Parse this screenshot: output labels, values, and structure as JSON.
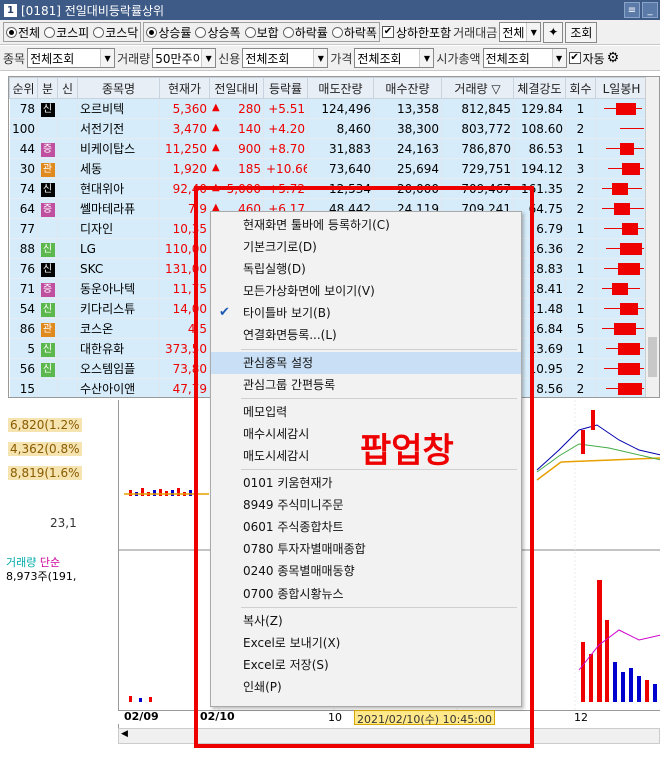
{
  "window": {
    "number": "1",
    "title": "[0181] 전일대비등락률상위"
  },
  "filters": {
    "market_radios": [
      {
        "label": "전체",
        "on": true
      },
      {
        "label": "코스피",
        "on": false
      },
      {
        "label": "코스닥",
        "on": false
      }
    ],
    "sort_radios": [
      {
        "label": "상승률",
        "on": true
      },
      {
        "label": "상승폭",
        "on": false
      },
      {
        "label": "보합",
        "on": false
      },
      {
        "label": "하락률",
        "on": false
      },
      {
        "label": "하락폭",
        "on": false
      }
    ],
    "limit_check": {
      "label": "상하한포함",
      "checked": true
    },
    "trade_amount_label": "거래대금",
    "trade_amount_value": "전체",
    "lookup_button": "조회",
    "item_label": "종목",
    "item_value": "전체조회",
    "volume_label": "거래량",
    "volume_value": "50만주이상",
    "credit_label": "신용",
    "credit_value": "전체조회",
    "price_label": "가격",
    "price_value": "전체조회",
    "mcap_label": "시가총액",
    "mcap_value": "전체조회",
    "auto_check": {
      "label": "자동",
      "checked": true
    }
  },
  "table": {
    "headers": [
      "순위",
      "분",
      "신",
      "종목명",
      "현재가",
      "전일대비",
      "등락률",
      "매도잔량",
      "매수잔량",
      "거래량 ▽",
      "체결강도",
      "회수",
      "L일봉H"
    ],
    "rows": [
      {
        "rank": "78",
        "tag": "신",
        "tag_type": "sin",
        "name": "오르비텍",
        "price": "5,360",
        "chg": "280",
        "rate": "+5.51",
        "ask": "124,496",
        "bid": "13,358",
        "vol": "812,845",
        "str": "129.84",
        "cnt": "1"
      },
      {
        "rank": "100",
        "tag": "",
        "tag_type": "",
        "name": "서전기전",
        "price": "3,470",
        "chg": "140",
        "rate": "+4.20",
        "ask": "8,460",
        "bid": "38,300",
        "vol": "803,772",
        "str": "108.60",
        "cnt": "2"
      },
      {
        "rank": "44",
        "tag": "증",
        "tag_type": "jung",
        "name": "비케이탑스",
        "price": "11,250",
        "chg": "900",
        "rate": "+8.70",
        "ask": "31,883",
        "bid": "24,163",
        "vol": "786,870",
        "str": "86.53",
        "cnt": "1"
      },
      {
        "rank": "30",
        "tag": "관",
        "tag_type": "pan",
        "name": "세동",
        "price": "1,920",
        "chg": "185",
        "rate": "+10.66",
        "ask": "73,640",
        "bid": "25,694",
        "vol": "729,751",
        "str": "194.12",
        "cnt": "3"
      },
      {
        "rank": "74",
        "tag": "신",
        "tag_type": "sin",
        "name": "현대위아",
        "price": "92,40",
        "chg": "5,000",
        "rate": "+5.72",
        "ask": "12,534",
        "bid": "20,000",
        "vol": "709,467",
        "str": "161.35",
        "cnt": "2"
      },
      {
        "rank": "64",
        "tag": "증",
        "tag_type": "jung",
        "name": "쎌마테라퓨",
        "price": "7,9",
        "chg": "460",
        "rate": "+6.17",
        "ask": "48,442",
        "bid": "24,119",
        "vol": "709,241",
        "str": "64.75",
        "cnt": "2"
      },
      {
        "rank": "77",
        "tag": "",
        "tag_type": "",
        "name": "디자인",
        "price": "10,35",
        "chg": "",
        "rate": "",
        "ask": "",
        "bid": "",
        "vol": "",
        "str": "6.79",
        "cnt": "1"
      },
      {
        "rank": "88",
        "tag": "신",
        "tag_type": "sin2",
        "name": "LG",
        "price": "110,00",
        "chg": "",
        "rate": "",
        "ask": "",
        "bid": "",
        "vol": "",
        "str": "16.36",
        "cnt": "2"
      },
      {
        "rank": "76",
        "tag": "신",
        "tag_type": "sin",
        "name": "SKC",
        "price": "131,00",
        "chg": "",
        "rate": "",
        "ask": "",
        "bid": "",
        "vol": "",
        "str": "18.83",
        "cnt": "1"
      },
      {
        "rank": "71",
        "tag": "증",
        "tag_type": "jung",
        "name": "동운아나텍",
        "price": "11,75",
        "chg": "",
        "rate": "",
        "ask": "",
        "bid": "",
        "vol": "",
        "str": "18.41",
        "cnt": "2"
      },
      {
        "rank": "54",
        "tag": "신",
        "tag_type": "sin2",
        "name": "키다리스튜",
        "price": "14,00",
        "chg": "",
        "rate": "",
        "ask": "",
        "bid": "",
        "vol": "",
        "str": "11.48",
        "cnt": "1"
      },
      {
        "rank": "86",
        "tag": "관",
        "tag_type": "pan",
        "name": "코스온",
        "price": "4,5",
        "chg": "",
        "rate": "",
        "ask": "",
        "bid": "",
        "vol": "",
        "str": "16.84",
        "cnt": "5"
      },
      {
        "rank": "5",
        "tag": "신",
        "tag_type": "sin2",
        "name": "대한유화",
        "price": "373,50",
        "chg": "",
        "rate": "",
        "ask": "",
        "bid": "",
        "vol": "",
        "str": "13.69",
        "cnt": "1"
      },
      {
        "rank": "56",
        "tag": "신",
        "tag_type": "sin2",
        "name": "오스템임플",
        "price": "73,80",
        "chg": "",
        "rate": "",
        "ask": "",
        "bid": "",
        "vol": "",
        "str": "10.95",
        "cnt": "2"
      },
      {
        "rank": "15",
        "tag": "",
        "tag_type": "",
        "name": "수산아이앤",
        "price": "47,79",
        "chg": "",
        "rate": "",
        "ask": "",
        "bid": "",
        "vol": "",
        "str": "8.56",
        "cnt": "2"
      }
    ]
  },
  "chart": {
    "info1": "6,820(1.2%",
    "info2": "4,362(0.8%",
    "info3": "8,819(1.6%",
    "info4": "23,1",
    "vol_title": "거래량",
    "vol_unit": "단순",
    "vol_value": "8,973주(191,",
    "date_left": "02/09",
    "date_mid": "02/10",
    "date_10": "10",
    "date_11": "11",
    "date_12": "12",
    "tooltip": "2021/02/10(수) 10:45:00"
  },
  "menu": {
    "items": [
      {
        "label": "현재화면 툴바에 등록하기(C)",
        "check": false,
        "hl": false
      },
      {
        "label": "기본크기로(D)",
        "check": false,
        "hl": false
      },
      {
        "label": "독립실행(D)",
        "check": false,
        "hl": false
      },
      {
        "label": "모든가상화면에 보이기(V)",
        "check": false,
        "hl": false
      },
      {
        "label": "타이틀바 보기(B)",
        "check": true,
        "hl": false
      },
      {
        "label": "연결화면등록...(L)",
        "check": false,
        "hl": false,
        "sep_after": true
      },
      {
        "label": "관심종목 설정",
        "check": false,
        "hl": true
      },
      {
        "label": "관심그룹 간편등록",
        "check": false,
        "hl": false,
        "sep_after": true
      },
      {
        "label": "메모입력",
        "check": false,
        "hl": false
      },
      {
        "label": "매수시세감시",
        "check": false,
        "hl": false
      },
      {
        "label": "매도시세감시",
        "check": false,
        "hl": false,
        "sep_after": true
      },
      {
        "label": "0101 키움현재가",
        "check": false,
        "hl": false
      },
      {
        "label": "8949 주식미니주문",
        "check": false,
        "hl": false
      },
      {
        "label": "0601 주식종합차트",
        "check": false,
        "hl": false
      },
      {
        "label": "0780 투자자별매매종합",
        "check": false,
        "hl": false
      },
      {
        "label": "0240 종목별매매동향",
        "check": false,
        "hl": false
      },
      {
        "label": "0700 종합시황뉴스",
        "check": false,
        "hl": false,
        "sep_after": true
      },
      {
        "label": "복사(Z)",
        "check": false,
        "hl": false
      },
      {
        "label": "Excel로 보내기(X)",
        "check": false,
        "hl": false
      },
      {
        "label": "Excel로 저장(S)",
        "check": false,
        "hl": false
      },
      {
        "label": "인쇄(P)",
        "check": false,
        "hl": false
      }
    ]
  },
  "annotation": {
    "label": "팝업창",
    "color": "#e00000"
  }
}
